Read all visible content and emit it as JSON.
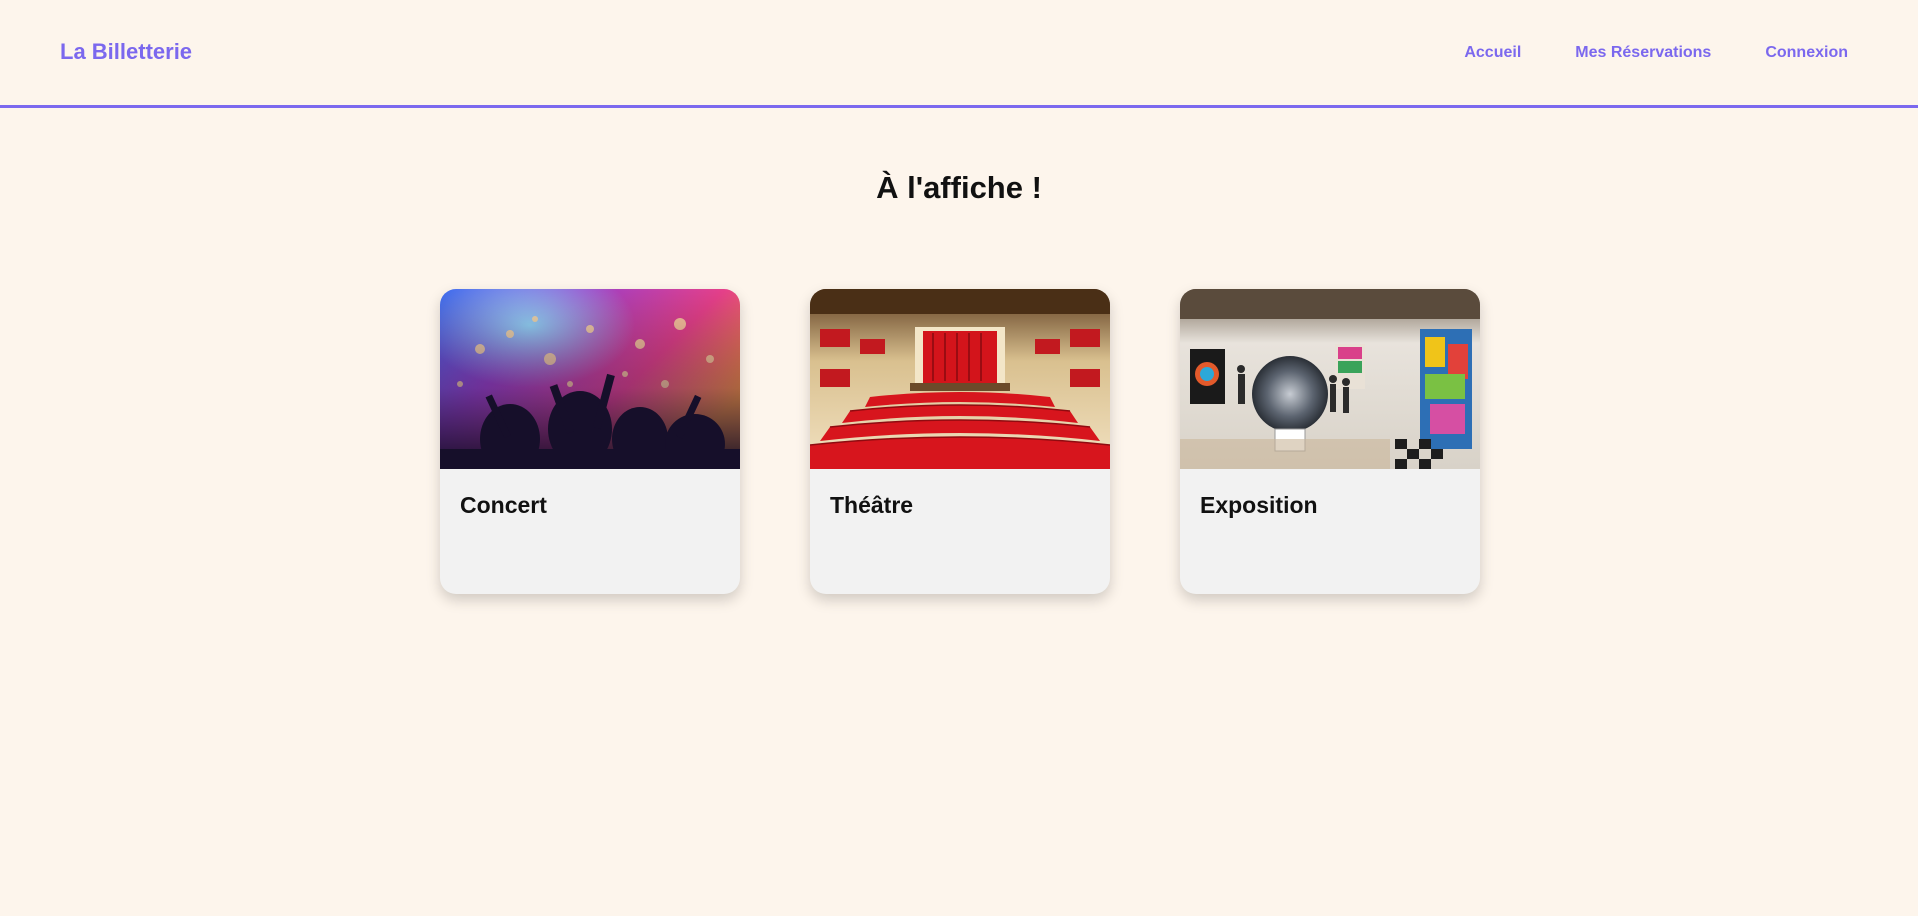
{
  "header": {
    "brand": "La Billetterie",
    "nav": [
      {
        "label": "Accueil"
      },
      {
        "label": "Mes Réservations"
      },
      {
        "label": "Connexion"
      }
    ]
  },
  "main": {
    "title": "À l'affiche !",
    "cards": [
      {
        "title": "Concert",
        "image": "concert-crowd-photo"
      },
      {
        "title": "Théâtre",
        "image": "theatre-hall-photo"
      },
      {
        "title": "Exposition",
        "image": "art-gallery-photo"
      }
    ]
  },
  "colors": {
    "accent": "#7b68ee",
    "background": "#fdf5ec",
    "card": "#f2f2f2"
  }
}
